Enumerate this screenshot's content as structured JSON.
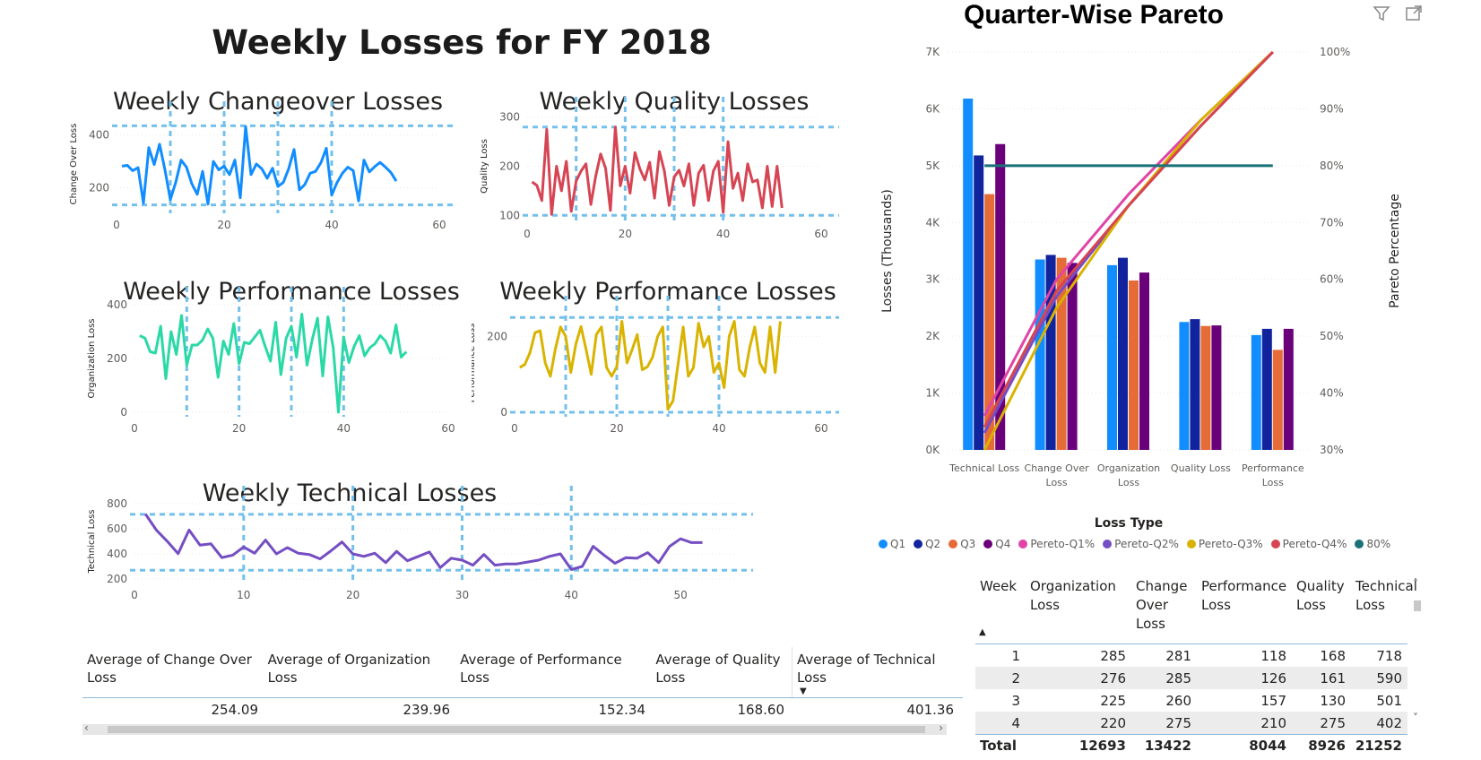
{
  "page": {
    "title": "Weekly Losses for FY 2018",
    "ref_line_color": "#74c0ec"
  },
  "chart_data": [
    {
      "type": "line",
      "title": "Weekly Changeover Losses",
      "ylabel": "Change Over Loss",
      "xlabel": "",
      "xlim": [
        0,
        60
      ],
      "ylim": [
        120,
        460
      ],
      "xticks": [
        0,
        20,
        40,
        60
      ],
      "yticks": [
        200,
        400
      ],
      "color": "#118dff",
      "vlines": [
        10,
        20,
        30,
        40
      ],
      "hlines": [
        135,
        435
      ],
      "x": [
        1,
        2,
        3,
        4,
        5,
        6,
        7,
        8,
        9,
        10,
        11,
        12,
        13,
        14,
        15,
        16,
        17,
        18,
        19,
        20,
        21,
        22,
        23,
        24,
        25,
        26,
        27,
        28,
        29,
        30,
        31,
        32,
        33,
        34,
        35,
        36,
        37,
        38,
        39,
        40,
        41,
        42,
        43,
        44,
        45,
        46,
        47,
        48,
        49,
        50,
        51,
        52
      ],
      "series": [
        {
          "values": [
            282,
            285,
            265,
            276,
            142,
            352,
            288,
            365,
            268,
            155,
            220,
            305,
            278,
            215,
            175,
            262,
            138,
            300,
            268,
            282,
            250,
            305,
            162,
            432,
            250,
            290,
            272,
            236,
            274,
            205,
            220,
            272,
            345,
            192,
            212,
            255,
            262,
            295,
            350,
            172,
            220,
            255,
            278,
            265,
            150,
            305,
            260,
            280,
            296,
            278,
            258,
            225
          ]
        }
      ]
    },
    {
      "type": "line",
      "title": "Weekly Quality Losses",
      "ylabel": "Quality Loss",
      "xlabel": "",
      "xlim": [
        0,
        60
      ],
      "ylim": [
        95,
        305
      ],
      "xticks": [
        0,
        20,
        40,
        60
      ],
      "yticks": [
        100,
        200,
        300
      ],
      "color": "#d64554",
      "vlines": [
        10,
        20,
        30,
        40
      ],
      "hlines": [
        100,
        280
      ],
      "x": [
        1,
        2,
        3,
        4,
        5,
        6,
        7,
        8,
        9,
        10,
        11,
        12,
        13,
        14,
        15,
        16,
        17,
        18,
        19,
        20,
        21,
        22,
        23,
        24,
        25,
        26,
        27,
        28,
        29,
        30,
        31,
        32,
        33,
        34,
        35,
        36,
        37,
        38,
        39,
        40,
        41,
        42,
        43,
        44,
        45,
        46,
        47,
        48,
        49,
        50,
        51,
        52
      ],
      "series": [
        {
          "values": [
            168,
            161,
            130,
            275,
            102,
            200,
            150,
            210,
            108,
            170,
            190,
            205,
            122,
            180,
            225,
            196,
            110,
            280,
            160,
            200,
            145,
            228,
            195,
            172,
            208,
            135,
            230,
            190,
            120,
            178,
            192,
            160,
            205,
            120,
            186,
            202,
            130,
            190,
            210,
            106,
            250,
            155,
            186,
            130,
            205,
            168,
            172,
            115,
            200,
            118,
            200,
            115
          ]
        }
      ]
    },
    {
      "type": "line",
      "title": "Weekly Performance Losses",
      "ylabel": "Organization Loss",
      "xlabel": "",
      "xlim": [
        0,
        60
      ],
      "ylim": [
        0,
        400
      ],
      "xticks": [
        0,
        20,
        40,
        60
      ],
      "yticks": [
        0,
        200,
        400
      ],
      "color": "#2ad9a6",
      "vlines": [
        10,
        20,
        30,
        40
      ],
      "hlines": [],
      "x": [
        1,
        2,
        3,
        4,
        5,
        6,
        7,
        8,
        9,
        10,
        11,
        12,
        13,
        14,
        15,
        16,
        17,
        18,
        19,
        20,
        21,
        22,
        23,
        24,
        25,
        26,
        27,
        28,
        29,
        30,
        31,
        32,
        33,
        34,
        35,
        36,
        37,
        38,
        39,
        40,
        41,
        42,
        43,
        44,
        45,
        46,
        47,
        48,
        49,
        50,
        51,
        52
      ],
      "series": [
        {
          "values": [
            285,
            276,
            225,
            220,
            320,
            125,
            300,
            215,
            360,
            175,
            250,
            250,
            268,
            310,
            275,
            130,
            265,
            215,
            330,
            180,
            260,
            255,
            280,
            305,
            245,
            190,
            335,
            140,
            275,
            320,
            205,
            365,
            175,
            270,
            350,
            135,
            355,
            240,
            0,
            280,
            185,
            245,
            285,
            210,
            240,
            255,
            285,
            265,
            220,
            325,
            205,
            225
          ]
        }
      ]
    },
    {
      "type": "line",
      "title": "Weekly Performance Losses",
      "ylabel": "Performance Loss",
      "xlabel": "",
      "xlim": [
        0,
        60
      ],
      "ylim": [
        0,
        260
      ],
      "xticks": [
        0,
        20,
        40,
        60
      ],
      "yticks": [
        0,
        200
      ],
      "color": "#d9b300",
      "vlines": [
        10,
        20,
        30,
        40
      ],
      "hlines": [
        0,
        250
      ],
      "x": [
        1,
        2,
        3,
        4,
        5,
        6,
        7,
        8,
        9,
        10,
        11,
        12,
        13,
        14,
        15,
        16,
        17,
        18,
        19,
        20,
        21,
        22,
        23,
        24,
        25,
        26,
        27,
        28,
        29,
        30,
        31,
        32,
        33,
        34,
        35,
        36,
        37,
        38,
        39,
        40,
        41,
        42,
        43,
        44,
        45,
        46,
        47,
        48,
        49,
        50,
        51,
        52
      ],
      "series": [
        {
          "values": [
            118,
            126,
            157,
            210,
            215,
            130,
            95,
            168,
            225,
            200,
            105,
            180,
            226,
            165,
            100,
            205,
            225,
            118,
            95,
            120,
            240,
            130,
            165,
            205,
            112,
            120,
            145,
            200,
            225,
            8,
            30,
            128,
            225,
            95,
            118,
            235,
            172,
            200,
            105,
            130,
            65,
            200,
            240,
            112,
            95,
            170,
            225,
            130,
            105,
            225,
            105,
            240
          ]
        }
      ]
    },
    {
      "type": "line",
      "title": "Weekly Technical Losses",
      "ylabel": "Technical Loss",
      "xlabel": "",
      "xlim": [
        0,
        55
      ],
      "ylim": [
        200,
        800
      ],
      "xticks": [
        0,
        10,
        20,
        30,
        40,
        50
      ],
      "yticks": [
        200,
        400,
        600,
        800
      ],
      "color": "#744ec2",
      "vlines": [
        10,
        20,
        30,
        40
      ],
      "hlines": [
        270,
        715
      ],
      "x": [
        1,
        2,
        3,
        4,
        5,
        6,
        7,
        8,
        9,
        10,
        11,
        12,
        13,
        14,
        15,
        16,
        17,
        18,
        19,
        20,
        21,
        22,
        23,
        24,
        25,
        26,
        27,
        28,
        29,
        30,
        31,
        32,
        33,
        34,
        35,
        36,
        37,
        38,
        39,
        40,
        41,
        42,
        43,
        44,
        45,
        46,
        47,
        48,
        49,
        50,
        51,
        52
      ],
      "series": [
        {
          "values": [
            718,
            590,
            501,
            402,
            590,
            470,
            480,
            370,
            390,
            455,
            405,
            510,
            400,
            450,
            405,
            395,
            360,
            425,
            495,
            400,
            380,
            405,
            330,
            420,
            345,
            380,
            415,
            290,
            365,
            350,
            310,
            395,
            310,
            320,
            320,
            335,
            350,
            380,
            400,
            275,
            300,
            460,
            390,
            325,
            370,
            365,
            410,
            330,
            460,
            520,
            490,
            490
          ]
        }
      ]
    },
    {
      "type": "bar",
      "title": "Quarter-Wise Pareto",
      "xlabel": "Loss Type",
      "ylabel": "Losses (Thousands)",
      "y2label": "Pareto Percentage",
      "categories": [
        "Technical Loss",
        "Change Over Loss",
        "Organization Loss",
        "Quality Loss",
        "Performance Loss"
      ],
      "ylim": [
        0,
        7000
      ],
      "yticks": [
        "0K",
        "1K",
        "2K",
        "3K",
        "4K",
        "5K",
        "6K",
        "7K"
      ],
      "y2lim": [
        30,
        100
      ],
      "y2ticks": [
        "30%",
        "40%",
        "50%",
        "60%",
        "70%",
        "80%",
        "90%",
        "100%"
      ],
      "legend_position": "bottom",
      "series": [
        {
          "name": "Q1",
          "color": "#118dff",
          "values": [
            6180,
            3350,
            3250,
            2250,
            2020
          ]
        },
        {
          "name": "Q2",
          "color": "#12239e",
          "values": [
            5180,
            3430,
            3380,
            2300,
            2130
          ]
        },
        {
          "name": "Q3",
          "color": "#e66c37",
          "values": [
            4500,
            3380,
            2980,
            2180,
            1760
          ]
        },
        {
          "name": "Q4",
          "color": "#6b007b",
          "values": [
            5380,
            3290,
            3120,
            2190,
            2130
          ]
        }
      ],
      "lines": [
        {
          "name": "Pereto-Q1%",
          "color": "#e044a7",
          "values": [
            36,
            60,
            75,
            88,
            100
          ]
        },
        {
          "name": "Pereto-Q2%",
          "color": "#744ec2",
          "values": [
            33,
            57,
            73,
            87,
            100
          ]
        },
        {
          "name": "Pereto-Q3%",
          "color": "#d9b300",
          "values": [
            30,
            55,
            73,
            88,
            100
          ]
        },
        {
          "name": "Pereto-Q4%",
          "color": "#d64550",
          "values": [
            34,
            58,
            73,
            87,
            100
          ]
        },
        {
          "name": "80%",
          "color": "#197278",
          "values": [
            80,
            80,
            80,
            80,
            80
          ]
        }
      ]
    }
  ],
  "avg_table": {
    "headers": [
      "Average of Change Over Loss",
      "Average of Organization Loss",
      "Average of Performance Loss",
      "Average of Quality Loss",
      "Average of Technical Loss"
    ],
    "values": [
      "254.09",
      "239.96",
      "152.34",
      "168.60",
      "401.36"
    ]
  },
  "week_table": {
    "headers": [
      "Week",
      "Organization Loss",
      "Change Over Loss",
      "Performance Loss",
      "Quality Loss",
      "Technical Loss"
    ],
    "rows": [
      [
        "1",
        "285",
        "281",
        "118",
        "168",
        "718"
      ],
      [
        "2",
        "276",
        "285",
        "126",
        "161",
        "590"
      ],
      [
        "3",
        "225",
        "260",
        "157",
        "130",
        "501"
      ],
      [
        "4",
        "220",
        "275",
        "210",
        "275",
        "402"
      ]
    ],
    "total": [
      "Total",
      "12693",
      "13422",
      "8044",
      "8926",
      "21252"
    ]
  }
}
